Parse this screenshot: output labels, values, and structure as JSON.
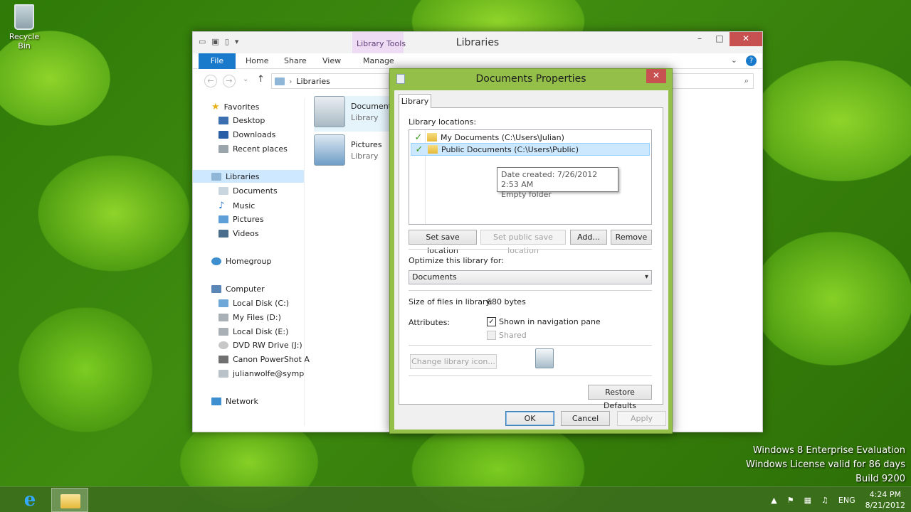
{
  "desktop": {
    "recycle_bin": "Recycle Bin",
    "watermark": [
      "Windows 8 Enterprise Evaluation",
      "Windows License valid for 86 days",
      "Build 9200"
    ]
  },
  "explorer": {
    "title": "Libraries",
    "contextual_tab": "Library Tools",
    "tabs": [
      "File",
      "Home",
      "Share",
      "View",
      "Manage"
    ],
    "address": "Libraries",
    "nav": {
      "favorites": "Favorites",
      "favorites_items": [
        "Desktop",
        "Downloads",
        "Recent places"
      ],
      "libraries": "Libraries",
      "libraries_items": [
        "Documents",
        "Music",
        "Pictures",
        "Videos"
      ],
      "homegroup": "Homegroup",
      "computer": "Computer",
      "computer_items": [
        "Local Disk (C:)",
        "My Files (D:)",
        "Local Disk (E:)",
        "DVD RW Drive (J:)",
        "Canon PowerShot A",
        "julianwolfe@sympat"
      ],
      "network": "Network"
    },
    "content": [
      {
        "name": "Document",
        "type": "Library"
      },
      {
        "name": "Pictures",
        "type": "Library"
      }
    ]
  },
  "dialog": {
    "title": "Documents Properties",
    "tab": "Library",
    "locations_label": "Library locations:",
    "locations": [
      {
        "label": "My Documents (C:\\Users\\Julian)"
      },
      {
        "label": "Public Documents (C:\\Users\\Public)"
      }
    ],
    "tooltip": {
      "line1": "Date created: 7/26/2012 2:53 AM",
      "line2": "Empty folder"
    },
    "buttons": {
      "set_save": "Set save location",
      "set_public": "Set public save location",
      "add": "Add...",
      "remove": "Remove",
      "change_icon": "Change library icon...",
      "restore": "Restore Defaults",
      "ok": "OK",
      "cancel": "Cancel",
      "apply": "Apply"
    },
    "optimize_label": "Optimize this library for:",
    "optimize_value": "Documents",
    "size_label": "Size of files in library:",
    "size_value": "680 bytes",
    "attributes_label": "Attributes:",
    "attr_nav": "Shown in navigation pane",
    "attr_shared": "Shared"
  },
  "taskbar": {
    "lang": "ENG",
    "time": "4:24 PM",
    "date": "8/21/2012"
  },
  "colors": {
    "accent": "#1979ca",
    "dialog_frame": "#94c04a",
    "close": "#c75050"
  }
}
